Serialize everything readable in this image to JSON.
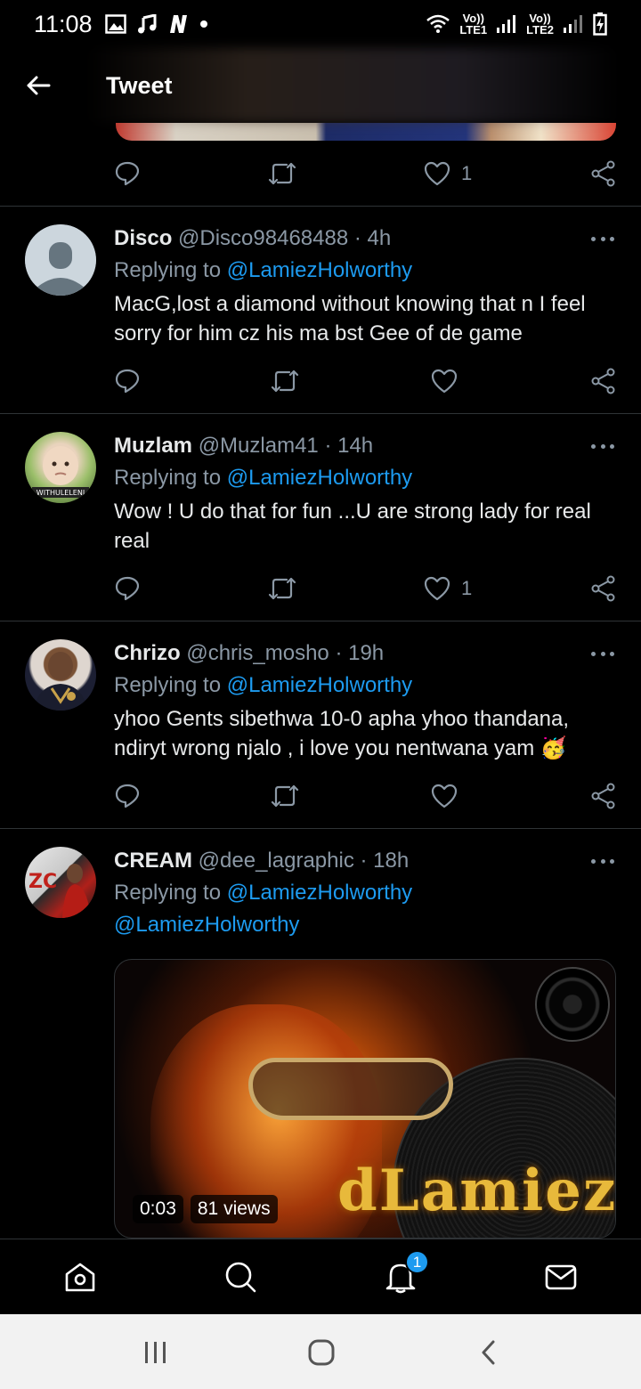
{
  "status_bar": {
    "time": "11:08",
    "icons": [
      "gallery-icon",
      "music-icon",
      "netflix-n-icon",
      "dot-icon"
    ],
    "sim1_label": "LTE1",
    "sim2_label": "LTE2",
    "volte1": "Vo))",
    "volte2": "Vo))"
  },
  "header": {
    "title": "Tweet"
  },
  "previous_tweet_actions": {
    "like_count": "1"
  },
  "replies": [
    {
      "name": "Disco",
      "handle": "@Disco98468488",
      "time": "· 4h",
      "replying_prefix": "Replying to",
      "replying_to": "@LamiezHolworthy",
      "text": "MacG,lost a diamond without knowing that n I feel sorry for him cz his ma bst Gee of de game",
      "like_count": ""
    },
    {
      "name": "Muzlam",
      "handle": "@Muzlam41",
      "time": "· 14h",
      "replying_prefix": "Replying to",
      "replying_to": "@LamiezHolworthy",
      "text": "Wow ! U do that for fun ...U are strong lady for real real",
      "like_count": "1"
    },
    {
      "name": "Chrizo",
      "handle": "@chris_mosho",
      "time": "· 19h",
      "replying_prefix": "Replying to",
      "replying_to": "@LamiezHolworthy",
      "text": "yhoo Gents sibethwa 10-0 apha yhoo thandana, ndiryt wrong njalo , i love you  nentwana yam 🥳",
      "like_count": ""
    },
    {
      "name": "CREAM",
      "handle": "@dee_lagraphic",
      "time": "· 18h",
      "replying_prefix": "Replying to",
      "replying_to": "@LamiezHolworthy",
      "mention": "@LamiezHolworthy"
    }
  ],
  "video": {
    "duration": "0:03",
    "views": "81 views",
    "logo_text": "dLamiez"
  },
  "bottom_nav": {
    "notifications_badge": "1"
  },
  "colors": {
    "link": "#1d9bf0",
    "muted": "#8b98a5",
    "background": "#000000"
  }
}
